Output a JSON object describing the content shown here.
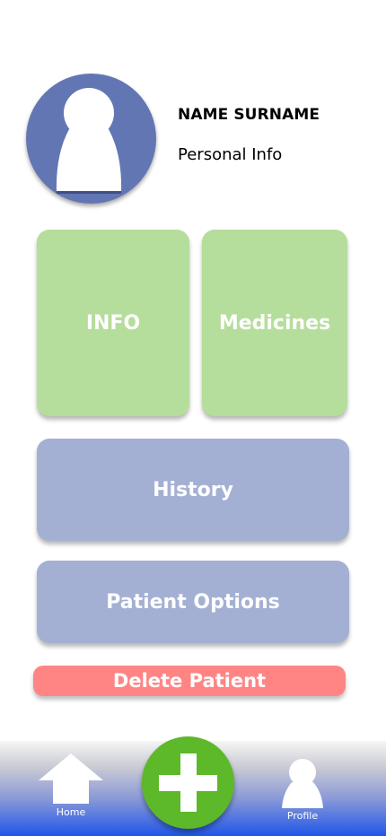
{
  "patient": {
    "name": "NAME SURNAME",
    "subtitle": "Personal Info"
  },
  "tiles": {
    "info": "INFO",
    "medicines": "Medicines",
    "history": "History",
    "patient_options": "Patient Options"
  },
  "actions": {
    "delete_patient": "Delete Patient"
  },
  "bottom_nav": {
    "home_label": "Home",
    "profile_label": "Profile",
    "add_icon": "plus-icon"
  },
  "colors": {
    "avatar_bg": "#6376b4",
    "tile_green": "#b5dd9b",
    "tile_blue": "#a4b0d3",
    "delete_red": "#ff8585",
    "add_green": "#5db82a",
    "nav_blue": "#1f56e8"
  }
}
